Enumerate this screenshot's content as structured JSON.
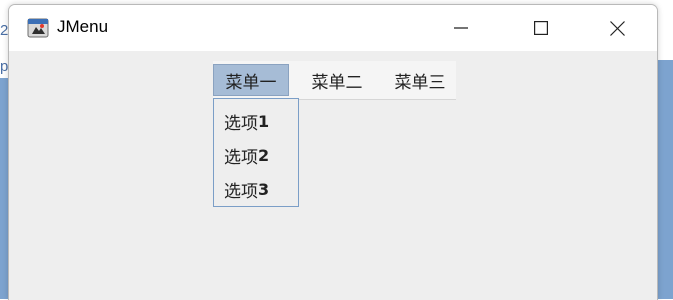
{
  "window": {
    "title": "JMenu",
    "controls": {
      "minimize_icon": "minimize-icon",
      "maximize_icon": "maximize-icon",
      "close_icon": "close-icon"
    }
  },
  "menubar": {
    "menus": [
      {
        "label": "菜单一",
        "active": true
      },
      {
        "label": "菜单二",
        "active": false
      },
      {
        "label": "菜单三",
        "active": false
      }
    ]
  },
  "dropdown": {
    "items": [
      {
        "label": "选项",
        "number": "1"
      },
      {
        "label": "选项",
        "number": "2"
      },
      {
        "label": "选项",
        "number": "3"
      }
    ]
  },
  "background": {
    "left_glyphs": [
      "2",
      "p"
    ]
  },
  "colors": {
    "active_menu_bg": "#a6bcd6",
    "dropdown_border": "#7b9ec7",
    "window_bg": "#eeeeee",
    "desktop_accent": "#7da3cf"
  }
}
